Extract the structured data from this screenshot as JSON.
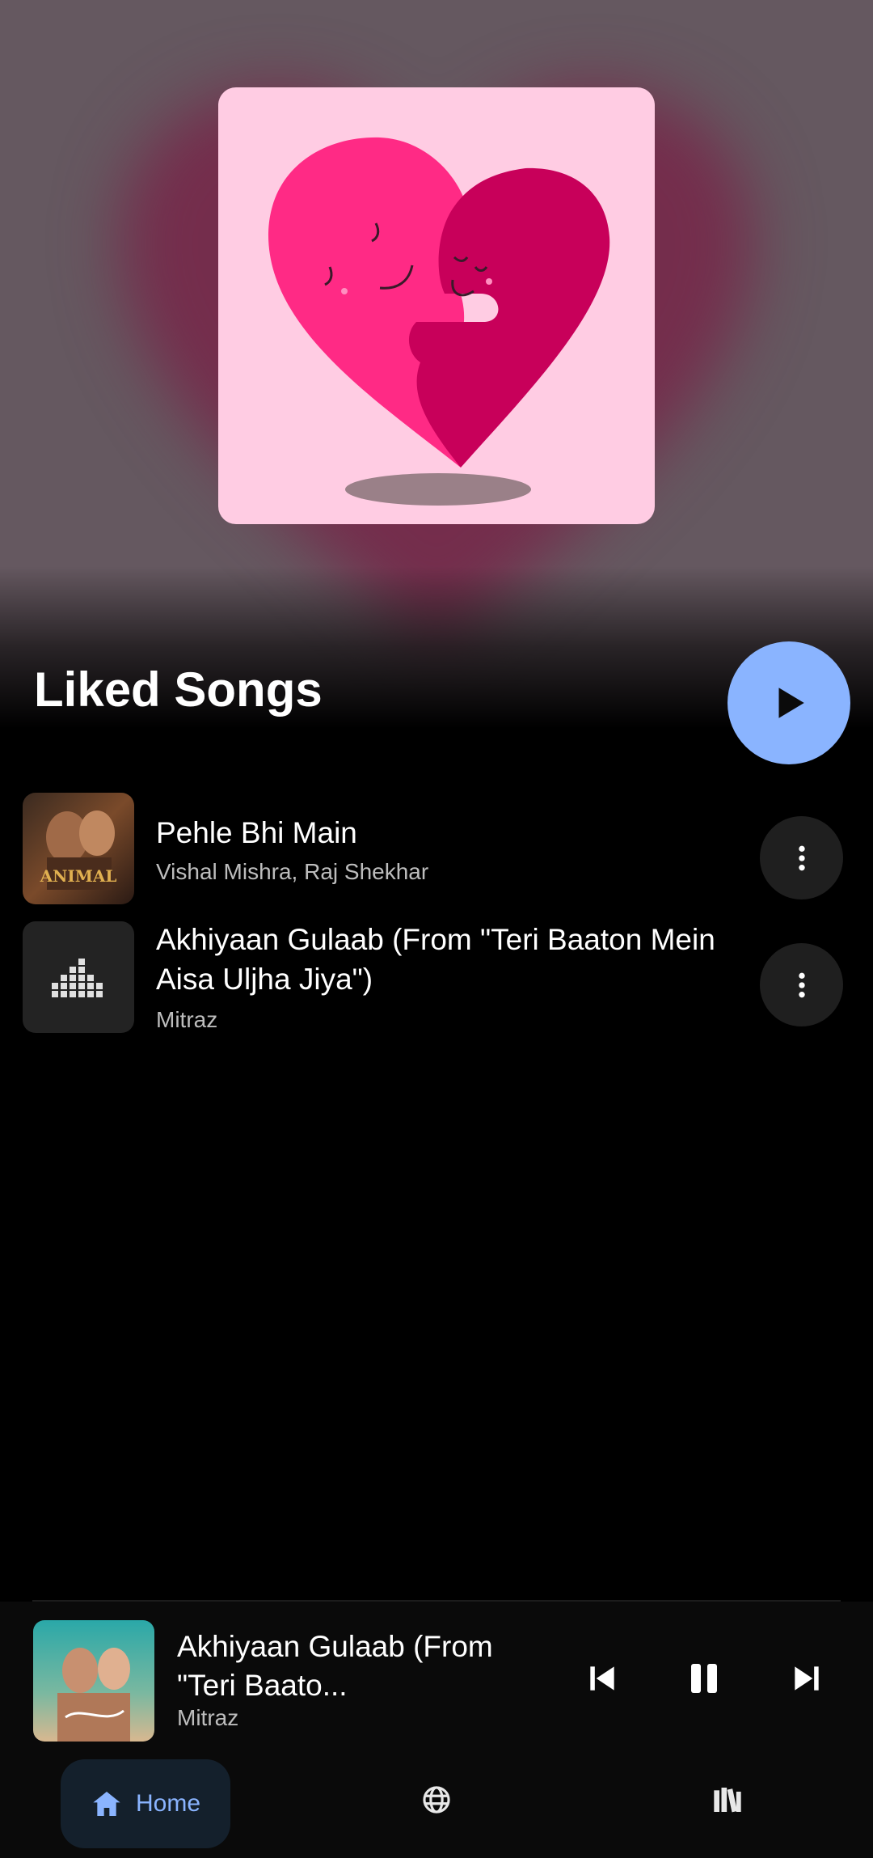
{
  "playlist": {
    "title": "Liked Songs",
    "play_icon": "play-icon"
  },
  "songs": [
    {
      "title": "Pehle Bhi Main",
      "artist": "Vishal Mishra, Raj Shekhar",
      "art_text": "ANIMAL",
      "menu_icon": "more-vert-icon"
    },
    {
      "title": "Akhiyaan Gulaab (From \"Teri Baaton Mein Aisa Uljha Jiya\")",
      "artist": "Mitraz",
      "menu_icon": "more-vert-icon"
    }
  ],
  "now_playing": {
    "title": "Akhiyaan Gulaab (From \"Teri Baato...",
    "artist": "Mitraz",
    "controls": [
      "skip-previous-icon",
      "pause-icon",
      "skip-next-icon"
    ]
  },
  "nav": {
    "home_label": "Home",
    "explore_icon": "globe-icon",
    "library_icon": "library-icon"
  },
  "colors": {
    "accent": "#8ab4ff",
    "cover_bg": "#ffcce3",
    "heart_left": "#ff2a85",
    "heart_right": "#c8005a",
    "header_bg": "#655860"
  }
}
